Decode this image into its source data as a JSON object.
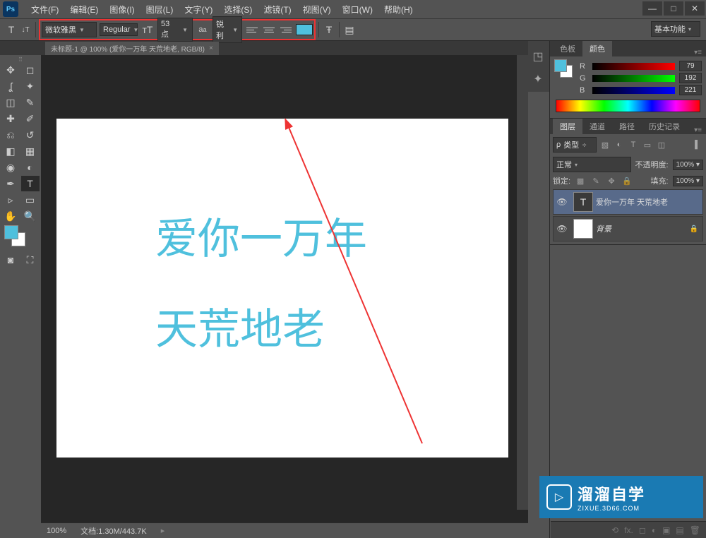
{
  "menu": {
    "file": "文件(F)",
    "edit": "编辑(E)",
    "image": "图像(I)",
    "layer": "图层(L)",
    "type": "文字(Y)",
    "select": "选择(S)",
    "filter": "滤镜(T)",
    "view": "视图(V)",
    "window": "窗口(W)",
    "help": "帮助(H)"
  },
  "options": {
    "font_family": "微软雅黑",
    "font_style": "Regular",
    "font_size": "53 点",
    "antialias": "锐利",
    "workspace": "基本功能"
  },
  "doc": {
    "tab": "未标题-1 @ 100% (爱你一万年 天荒地老, RGB/8)",
    "close": "×"
  },
  "canvas": {
    "line1": "爱你一万年",
    "line2": "天荒地老"
  },
  "status": {
    "zoom": "100%",
    "docinfo": "文档:1.30M/443.7K"
  },
  "color_panel": {
    "tab_swatch": "色板",
    "tab_color": "颜色",
    "r_label": "R",
    "r_val": "79",
    "g_label": "G",
    "g_val": "192",
    "b_label": "B",
    "b_val": "221"
  },
  "layers_panel": {
    "tab_layers": "图层",
    "tab_channels": "通道",
    "tab_paths": "路径",
    "tab_history": "历史记录",
    "kind": "类型",
    "blend": "正常",
    "opacity_label": "不透明度:",
    "opacity_val": "100%",
    "lock_label": "锁定:",
    "fill_label": "填充:",
    "fill_val": "100%",
    "layer1": "爱你一万年 天荒地老",
    "layer2": "背景"
  },
  "watermark": {
    "main": "溜溜自学",
    "sub": "ZIXUE.3D66.COM"
  }
}
